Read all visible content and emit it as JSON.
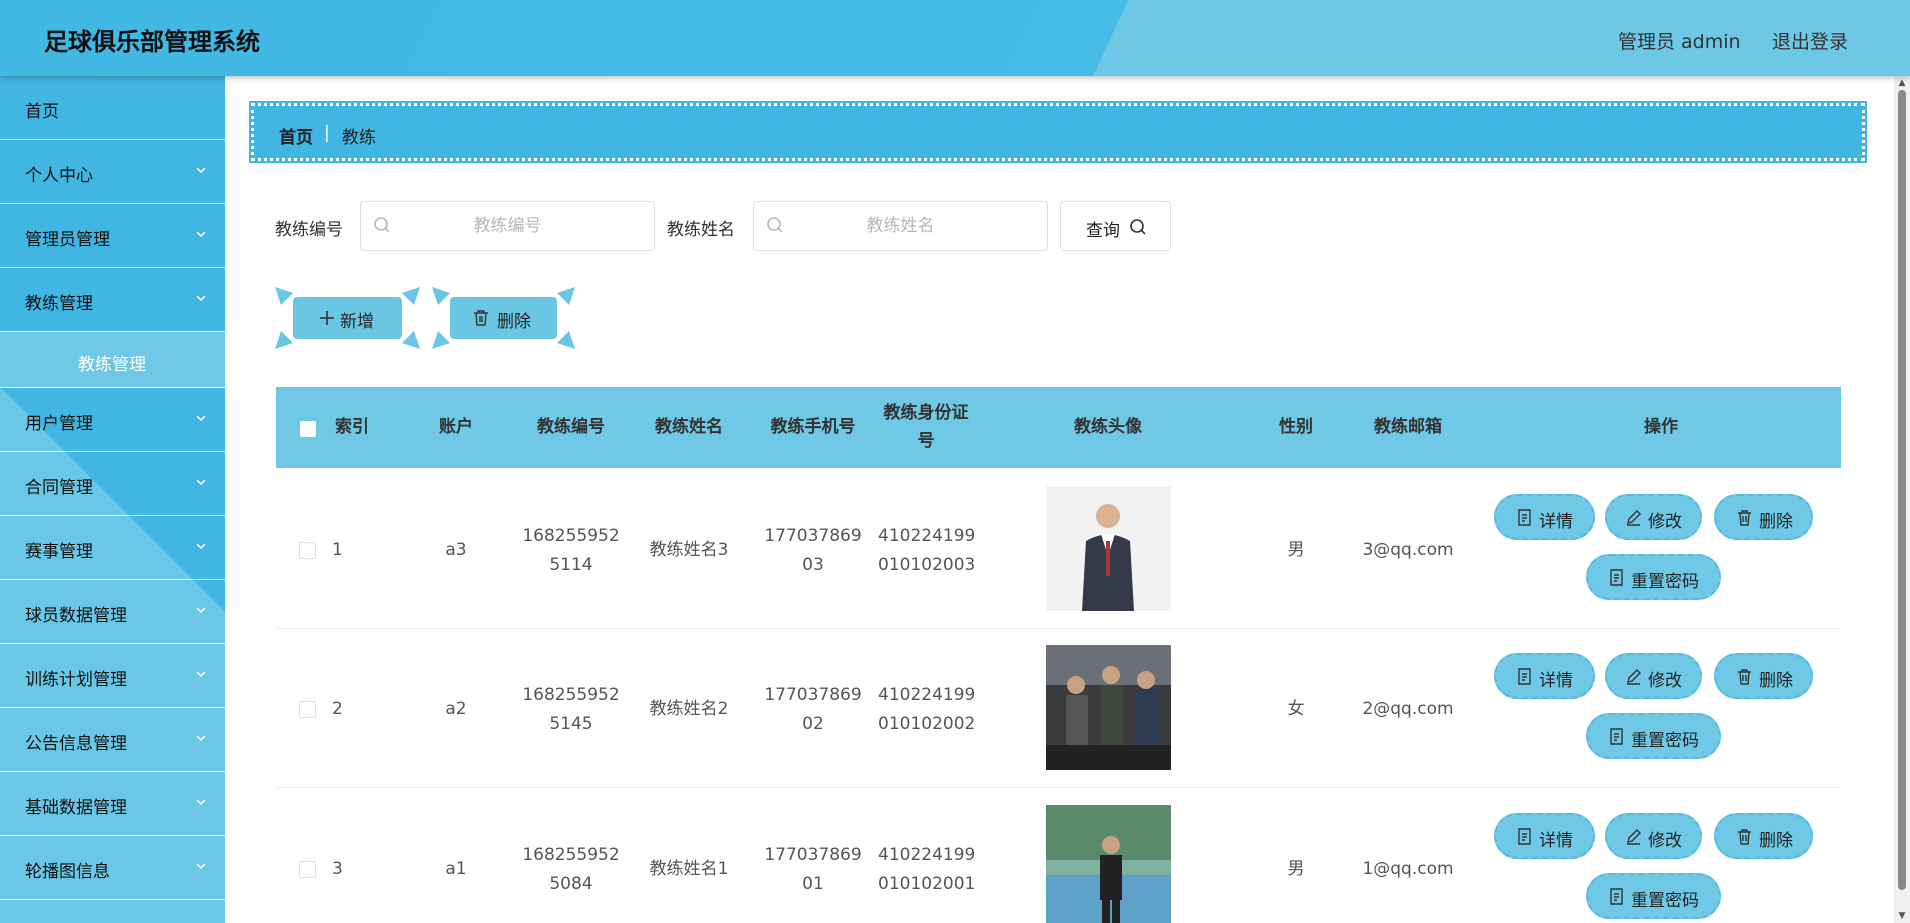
{
  "header": {
    "title": "足球俱乐部管理系统",
    "user": "管理员 admin",
    "logout": "退出登录"
  },
  "sidebar": {
    "items": [
      {
        "label": "首页",
        "chevron": false
      },
      {
        "label": "个人中心",
        "chevron": true
      },
      {
        "label": "管理员管理",
        "chevron": true
      },
      {
        "label": "教练管理",
        "chevron": true
      },
      {
        "label": "教练管理",
        "sub": true
      },
      {
        "label": "用户管理",
        "chevron": true
      },
      {
        "label": "合同管理",
        "chevron": true
      },
      {
        "label": "赛事管理",
        "chevron": true
      },
      {
        "label": "球员数据管理",
        "chevron": true
      },
      {
        "label": "训练计划管理",
        "chevron": true
      },
      {
        "label": "公告信息管理",
        "chevron": true
      },
      {
        "label": "基础数据管理",
        "chevron": true
      },
      {
        "label": "轮播图信息",
        "chevron": true
      }
    ]
  },
  "breadcrumb": {
    "home": "首页",
    "separator": "|",
    "current": "教练"
  },
  "search": {
    "field1_label": "教练编号",
    "field1_placeholder": "教练编号",
    "field1_value": "",
    "field2_label": "教练姓名",
    "field2_placeholder": "教练姓名",
    "field2_value": "",
    "query_label": "查询"
  },
  "actions": {
    "add_label": "新增",
    "delete_label": "删除"
  },
  "table": {
    "headers": {
      "index": "索引",
      "account": "账户",
      "code": "教练编号",
      "name": "教练姓名",
      "phone": "教练手机号",
      "idcard": "教练身份证号",
      "photo": "教练头像",
      "gender": "性别",
      "email": "教练邮箱",
      "ops": "操作"
    },
    "rows": [
      {
        "index": "1",
        "account": "a3",
        "code": "1682559525114",
        "name": "教练姓名3",
        "phone": "17703786903",
        "idcard": "410224199010102003",
        "gender": "男",
        "email": "3@qq.com"
      },
      {
        "index": "2",
        "account": "a2",
        "code": "1682559525145",
        "name": "教练姓名2",
        "phone": "17703786902",
        "idcard": "410224199010102002",
        "gender": "女",
        "email": "2@qq.com"
      },
      {
        "index": "3",
        "account": "a1",
        "code": "1682559525084",
        "name": "教练姓名1",
        "phone": "17703786901",
        "idcard": "410224199010102001",
        "gender": "男",
        "email": "1@qq.com"
      }
    ],
    "ops": {
      "detail": "详情",
      "edit": "修改",
      "delete": "删除",
      "reset": "重置密码"
    }
  },
  "colors": {
    "primary": "#41b6e3",
    "light": "#6ec8e6"
  }
}
